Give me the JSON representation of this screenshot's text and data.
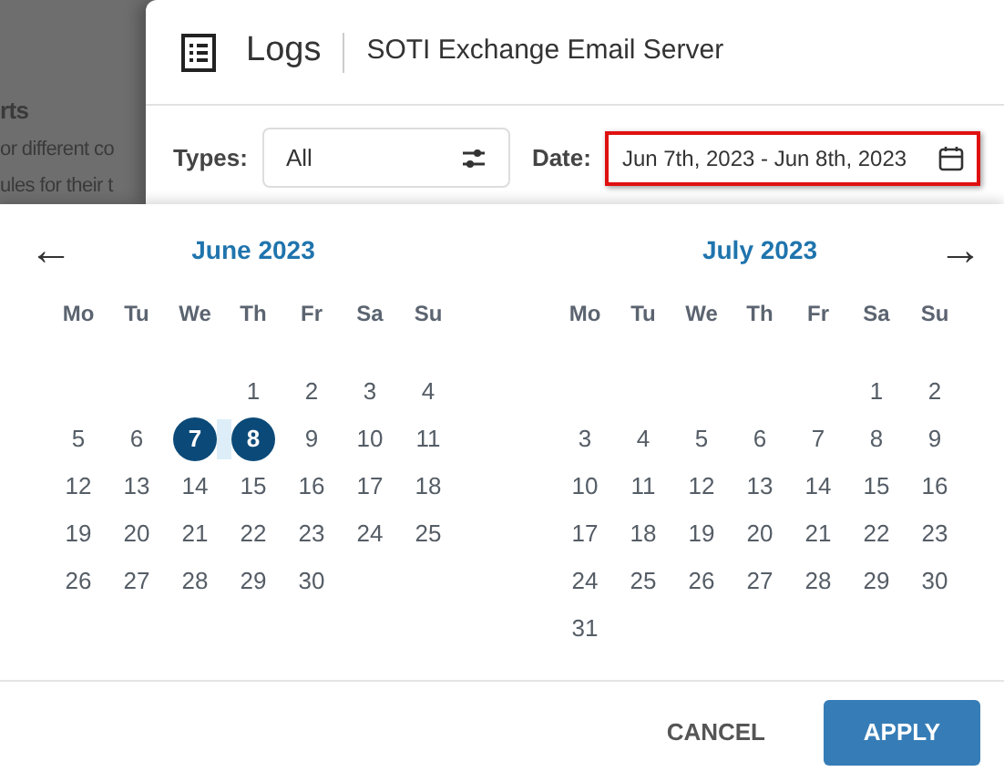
{
  "background_page": {
    "texts": [
      {
        "text": "rts",
        "kind": "heading"
      },
      {
        "text": "or different co",
        "kind": "body"
      },
      {
        "text": "ules for their t",
        "kind": "body"
      }
    ]
  },
  "dialog": {
    "title": "Logs",
    "subtitle": "SOTI Exchange Email Server"
  },
  "filters": {
    "types_label": "Types:",
    "types_value": "All",
    "date_label": "Date:",
    "date_value": "Jun 7th, 2023 - Jun 8th, 2023",
    "date_focused": true
  },
  "calendar": {
    "prev": "←",
    "next": "→",
    "months": [
      {
        "title": "June 2023",
        "weekdays": [
          "Mo",
          "Tu",
          "We",
          "Th",
          "Fr",
          "Sa",
          "Su"
        ],
        "weeks": [
          {
            "days": [
              {
                "label": "1",
                "selected": false
              },
              {
                "label": "2",
                "selected": false
              },
              {
                "label": "3",
                "selected": false
              },
              {
                "label": "4",
                "selected": false
              }
            ]
          },
          {
            "days": [
              {
                "label": "5",
                "selected": false
              },
              {
                "label": "6",
                "selected": false
              },
              {
                "label": "7",
                "selected": true
              },
              {
                "label": "8",
                "selected": true
              },
              {
                "label": "9",
                "selected": false
              },
              {
                "label": "10",
                "selected": false
              },
              {
                "label": "11",
                "selected": false
              }
            ]
          },
          {
            "days": [
              {
                "label": "12",
                "selected": false
              },
              {
                "label": "13",
                "selected": false
              },
              {
                "label": "14",
                "selected": false
              },
              {
                "label": "15",
                "selected": false
              },
              {
                "label": "16",
                "selected": false
              },
              {
                "label": "17",
                "selected": false
              },
              {
                "label": "18",
                "selected": false
              }
            ]
          },
          {
            "days": [
              {
                "label": "19",
                "selected": false
              },
              {
                "label": "20",
                "selected": false
              },
              {
                "label": "21",
                "selected": false
              },
              {
                "label": "22",
                "selected": false
              },
              {
                "label": "23",
                "selected": false
              },
              {
                "label": "24",
                "selected": false
              },
              {
                "label": "25",
                "selected": false
              }
            ]
          },
          {
            "days": [
              {
                "label": "26",
                "selected": false
              },
              {
                "label": "27",
                "selected": false
              },
              {
                "label": "28",
                "selected": false
              },
              {
                "label": "29",
                "selected": false
              },
              {
                "label": "30",
                "selected": false
              }
            ]
          }
        ]
      },
      {
        "title": "July 2023",
        "weekdays": [
          "Mo",
          "Tu",
          "We",
          "Th",
          "Fr",
          "Sa",
          "Su"
        ],
        "weeks": [
          {
            "days": [
              {
                "label": "1",
                "selected": false
              },
              {
                "label": "2",
                "selected": false
              }
            ]
          },
          {
            "days": [
              {
                "label": "3",
                "selected": false
              },
              {
                "label": "4",
                "selected": false
              },
              {
                "label": "5",
                "selected": false
              },
              {
                "label": "6",
                "selected": false
              },
              {
                "label": "7",
                "selected": false
              },
              {
                "label": "8",
                "selected": false
              },
              {
                "label": "9",
                "selected": false
              }
            ]
          },
          {
            "days": [
              {
                "label": "10",
                "selected": false
              },
              {
                "label": "11",
                "selected": false
              },
              {
                "label": "12",
                "selected": false
              },
              {
                "label": "13",
                "selected": false
              },
              {
                "label": "14",
                "selected": false
              },
              {
                "label": "15",
                "selected": false
              },
              {
                "label": "16",
                "selected": false
              }
            ]
          },
          {
            "days": [
              {
                "label": "17",
                "selected": false
              },
              {
                "label": "18",
                "selected": false
              },
              {
                "label": "19",
                "selected": false
              },
              {
                "label": "20",
                "selected": false
              },
              {
                "label": "21",
                "selected": false
              },
              {
                "label": "22",
                "selected": false
              },
              {
                "label": "23",
                "selected": false
              }
            ]
          },
          {
            "days": [
              {
                "label": "24",
                "selected": false
              },
              {
                "label": "25",
                "selected": false
              },
              {
                "label": "26",
                "selected": false
              },
              {
                "label": "27",
                "selected": false
              },
              {
                "label": "28",
                "selected": false
              },
              {
                "label": "29",
                "selected": false
              },
              {
                "label": "30",
                "selected": false
              }
            ]
          },
          {
            "days": [
              {
                "label": "31",
                "selected": false
              }
            ]
          }
        ]
      }
    ]
  },
  "buttons": {
    "cancel": "CANCEL",
    "apply": "APPLY"
  }
}
